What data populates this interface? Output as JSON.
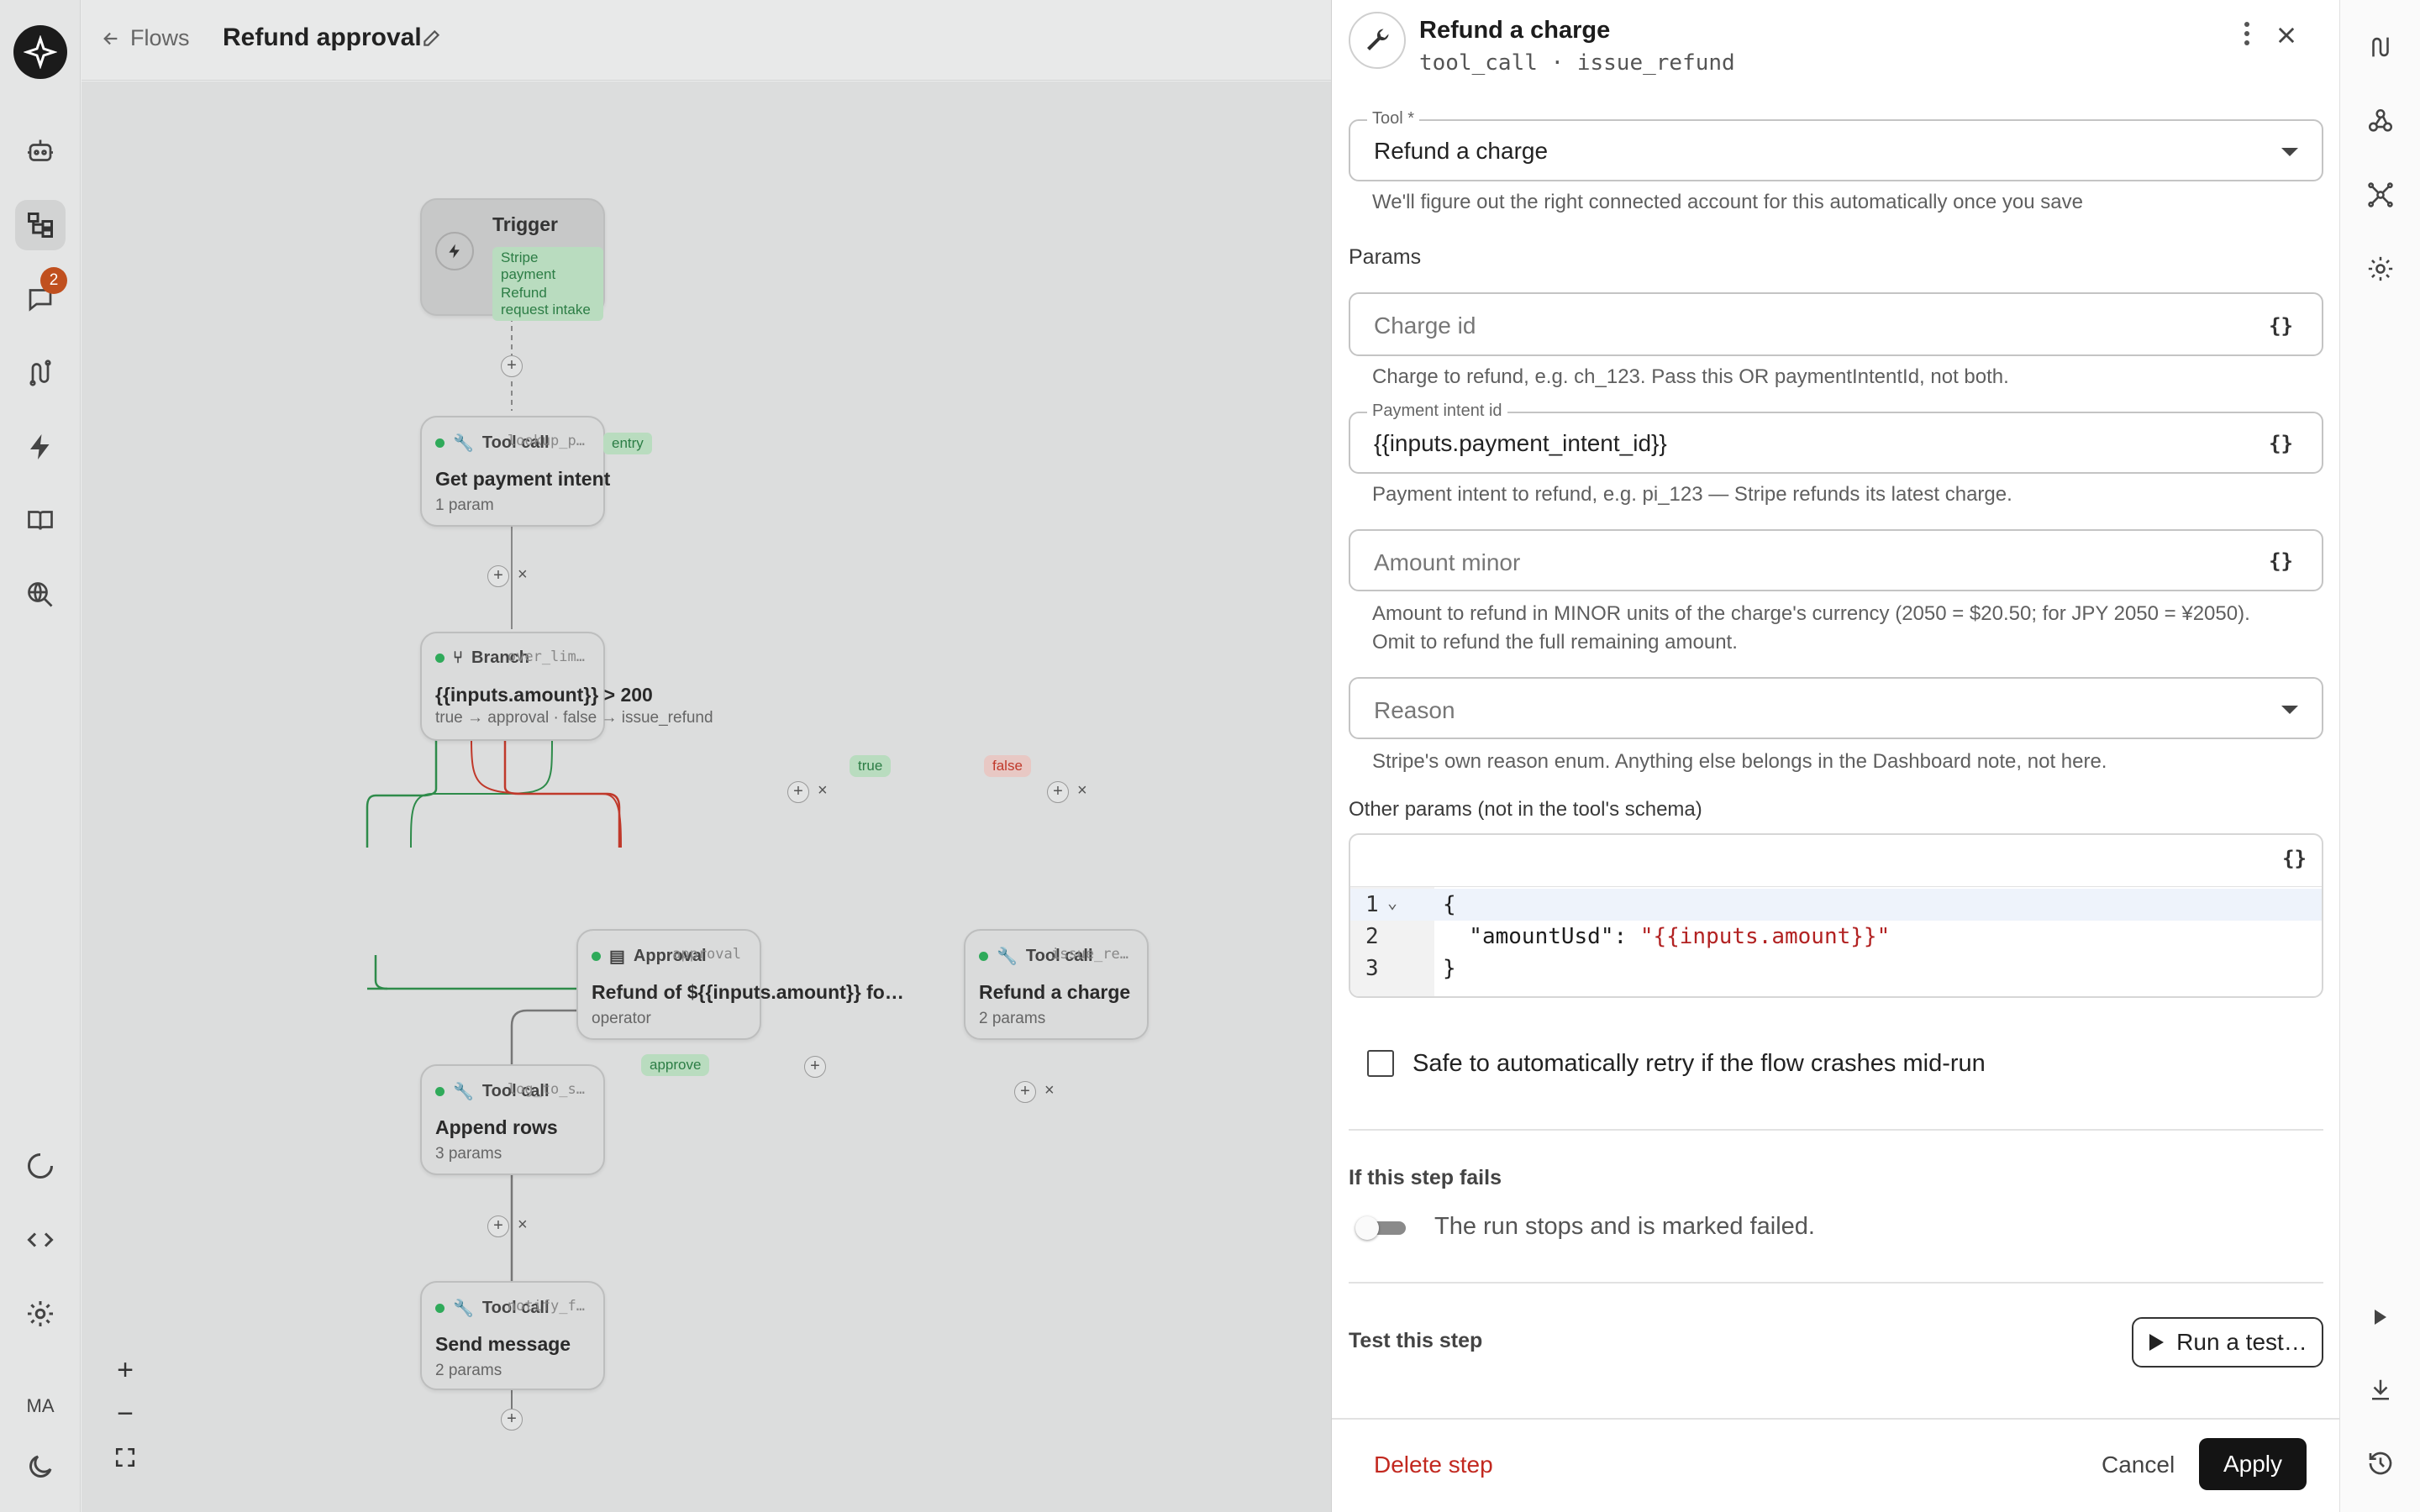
{
  "header": {
    "back_label": "Flows",
    "title": "Refund approval"
  },
  "left_rail": {
    "items": [
      {
        "icon": "agent-icon"
      },
      {
        "icon": "flows-icon",
        "active": true
      },
      {
        "icon": "chat-icon",
        "badge": "2"
      },
      {
        "icon": "routes-icon"
      },
      {
        "icon": "bolt-icon"
      },
      {
        "icon": "book-icon"
      },
      {
        "icon": "search-globe-icon"
      }
    ],
    "bottom": [
      {
        "icon": "loader-icon"
      },
      {
        "icon": "code-icon"
      },
      {
        "icon": "gear-icon"
      }
    ],
    "avatar": "MA",
    "theme_icon": "moon-icon"
  },
  "canvas": {
    "nodes": {
      "trigger": {
        "title": "Trigger",
        "chips": [
          "Stripe payment succeeded",
          "Refund request intake"
        ]
      },
      "get_payment": {
        "type": "Tool call",
        "tag": "entry",
        "id": "lookup_p…",
        "title": "Get payment intent",
        "sub": "1 param"
      },
      "branch": {
        "type": "Branch",
        "id": "over_lim…",
        "title": "{{inputs.amount}} > 200",
        "sub": "true → approval · false → issue_refund"
      },
      "approval": {
        "type": "Approval",
        "id": "approval",
        "title": "Refund of ${{inputs.amount}} for …",
        "sub": "operator"
      },
      "refund": {
        "type": "Tool call",
        "id": "issue_re…",
        "title": "Refund a charge",
        "sub": "2 params"
      },
      "append": {
        "type": "Tool call",
        "id": "log_to_s…",
        "title": "Append rows",
        "sub": "3 params"
      },
      "send": {
        "type": "Tool call",
        "id": "notify_f…",
        "title": "Send message",
        "sub": "2 params"
      }
    },
    "edge_labels": {
      "true": "true",
      "false": "false",
      "approve": "approve"
    },
    "colors": {
      "true_edge": "#2e8b4a",
      "false_edge": "#c0392b",
      "node_ok": "#2faa5a"
    }
  },
  "panel": {
    "title": "Refund a charge",
    "subtitle": "tool_call · issue_refund",
    "tool": {
      "label": "Tool *",
      "value": "Refund a charge",
      "helper": "We'll figure out the right connected account for this automatically once you save"
    },
    "params_heading": "Params",
    "charge_id": {
      "placeholder": "Charge id",
      "helper": "Charge to refund, e.g. ch_123. Pass this OR paymentIntentId, not both."
    },
    "payment_intent": {
      "label": "Payment intent id",
      "value": "{{inputs.payment_intent_id}}",
      "helper": "Payment intent to refund, e.g. pi_123 — Stripe refunds its latest charge."
    },
    "amount_minor": {
      "placeholder": "Amount minor",
      "helper_1": "Amount to refund in MINOR units of the charge's currency (2050 = $20.50; for JPY 2050 = ¥2050).",
      "helper_2": "Omit to refund the full remaining amount."
    },
    "reason": {
      "placeholder": "Reason",
      "helper": "Stripe's own reason enum. Anything else belongs in the Dashboard note, not here."
    },
    "other_params": {
      "label": "Other params (not in the tool's schema)",
      "line_numbers": [
        "1",
        "2",
        "3"
      ],
      "lines": {
        "open": "{",
        "key": "  \"amountUsd\": ",
        "value": "\"{{inputs.amount}}\"",
        "close": "}"
      }
    },
    "retry_label": "Safe to automatically retry if the flow crashes mid-run",
    "retry_checked": false,
    "fail_heading": "If this step fails",
    "fail_text": "The run stops and is marked failed.",
    "fail_toggle_on": false,
    "test_heading": "Test this step",
    "run_test_label": "Run a test…",
    "delete_label": "Delete step",
    "cancel_label": "Cancel",
    "apply_label": "Apply"
  },
  "right_rail": {
    "top": [
      {
        "icon": "routes-icon"
      },
      {
        "icon": "webhook-icon"
      },
      {
        "icon": "network-icon"
      },
      {
        "icon": "gear-icon"
      }
    ],
    "bottom": [
      {
        "icon": "play-icon"
      },
      {
        "icon": "download-icon"
      },
      {
        "icon": "history-icon"
      }
    ]
  }
}
